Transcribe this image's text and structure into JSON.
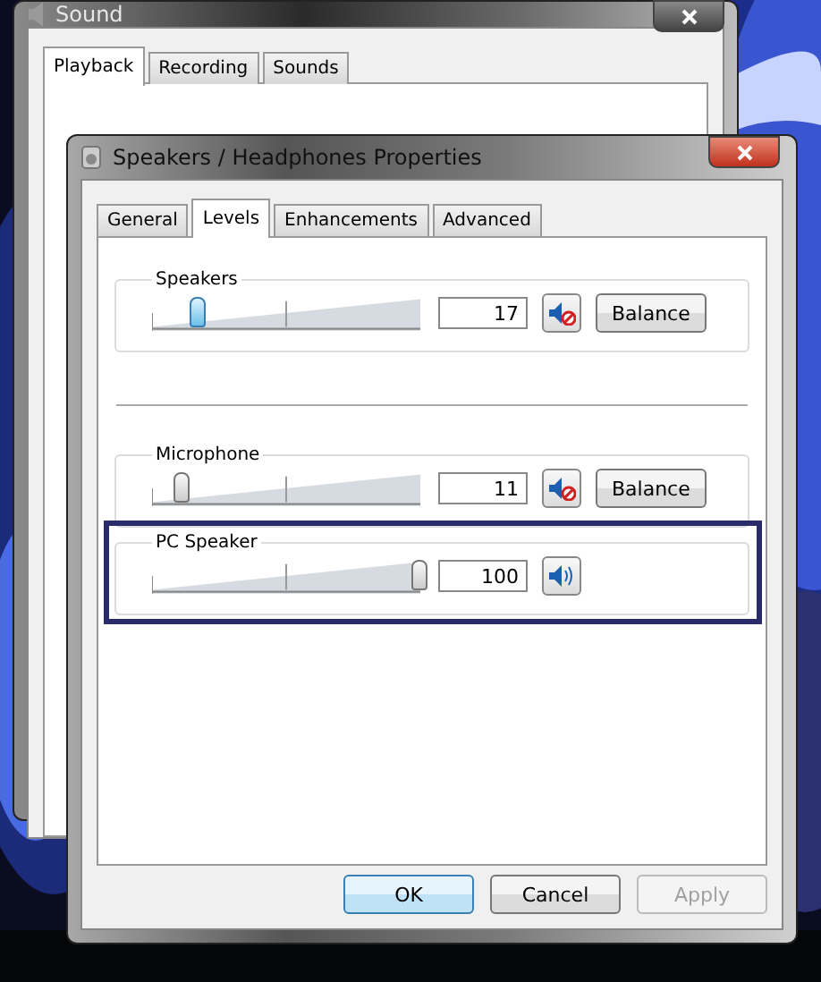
{
  "back_window": {
    "title": "Sound",
    "tabs": [
      {
        "label": "Playback",
        "selected": true
      },
      {
        "label": "Recording",
        "selected": false
      },
      {
        "label": "Sounds",
        "selected": false
      }
    ]
  },
  "dialog": {
    "title": "Speakers / Headphones Properties",
    "tabs": [
      {
        "label": "General",
        "selected": false
      },
      {
        "label": "Levels",
        "selected": true
      },
      {
        "label": "Enhancements",
        "selected": false
      },
      {
        "label": "Advanced",
        "selected": false
      }
    ],
    "channels": [
      {
        "name": "Speakers",
        "level": 0.17,
        "value": "17",
        "muted": true,
        "focused": true,
        "highlighted": false,
        "balance": "Balance",
        "separator_after": true
      },
      {
        "name": "Microphone",
        "level": 0.11,
        "value": "11",
        "muted": true,
        "focused": false,
        "highlighted": false,
        "balance": "Balance",
        "separator_after": false
      },
      {
        "name": "PC Speaker",
        "level": 1.0,
        "value": "100",
        "muted": false,
        "focused": false,
        "highlighted": true,
        "separator_after": false
      }
    ],
    "buttons": [
      {
        "label": "OK",
        "default": true,
        "disabled": false
      },
      {
        "label": "Cancel",
        "default": false,
        "disabled": false
      },
      {
        "label": "Apply",
        "default": false,
        "disabled": true
      }
    ]
  }
}
